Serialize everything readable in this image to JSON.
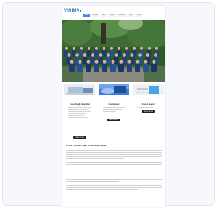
{
  "site": {
    "logo_text": "VIRIMA",
    "nav_items": [
      "Home",
      "Services",
      "About",
      "Careers",
      "Experience",
      "Blog",
      "Contact"
    ],
    "active_nav": 0,
    "colors": {
      "accent": "#3a8ce6",
      "logo": "#3a6fb0",
      "button": "#222222"
    }
  },
  "hero": {
    "image": "team-group-photo"
  },
  "features": [
    {
      "image": "laptop-image",
      "title": "Consulting & Integration",
      "button": "LEARN MORE"
    },
    {
      "image": "cloud-image",
      "title": "Development",
      "button": "LEARN MORE"
    },
    {
      "image": "tablet-image",
      "title": "Cloud & Support",
      "button": "LEARN MORE"
    }
  ],
  "article": {
    "title": "We are a software team of passionate people"
  }
}
